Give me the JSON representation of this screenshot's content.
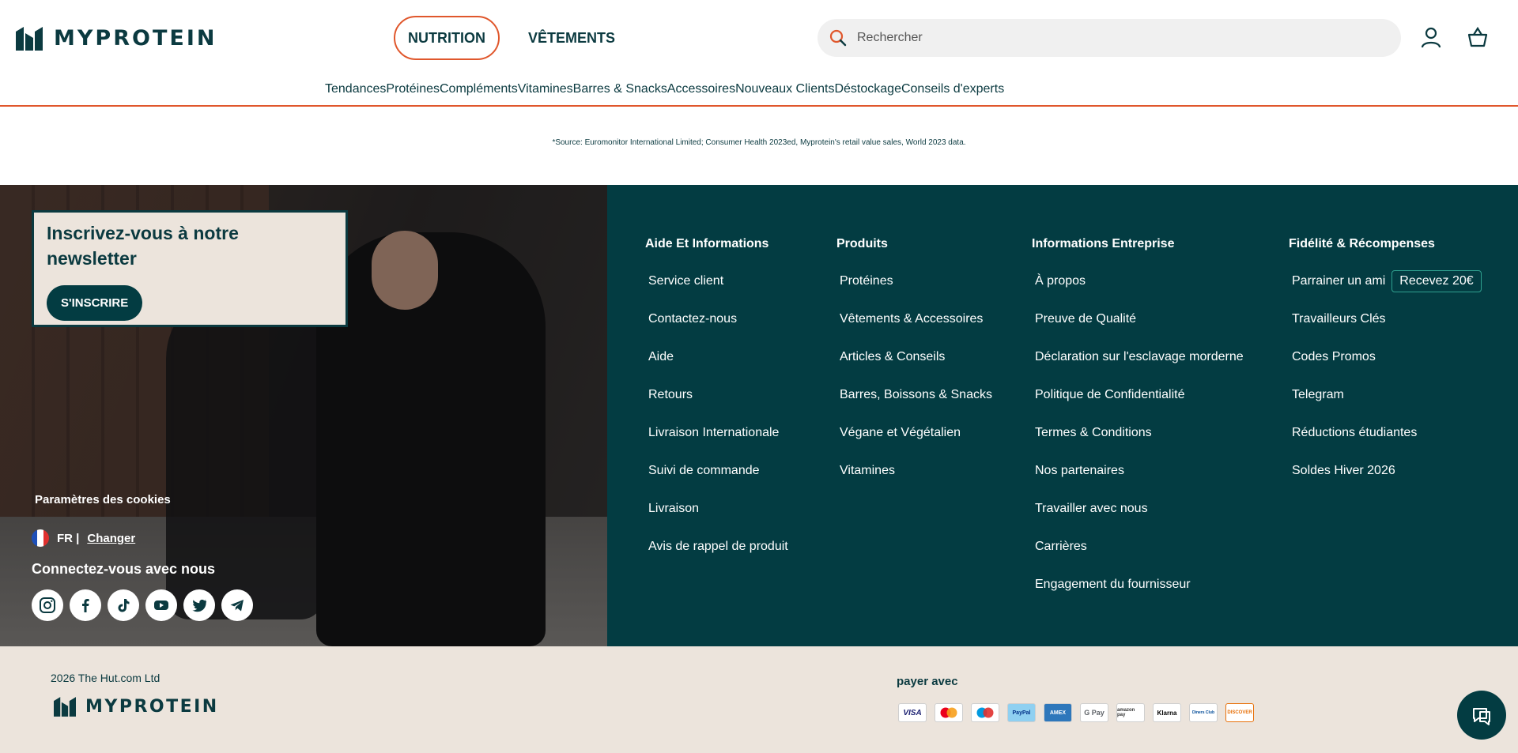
{
  "brand": {
    "name": "MYPROTEIN"
  },
  "header": {
    "tabs": [
      {
        "label": "NUTRITION",
        "active": true
      },
      {
        "label": "VÊTEMENTS",
        "active": false
      }
    ],
    "search": {
      "placeholder": "Rechercher",
      "value": ""
    },
    "icons": [
      "account-icon",
      "basket-icon"
    ]
  },
  "nav": [
    "Tendances",
    "Protéines",
    "Compléments",
    "Vitamines",
    "Barres & Snacks",
    "Accessoires",
    "Nouveaux Clients",
    "Déstockage",
    "Conseils d'experts"
  ],
  "source_note": "*Source: Euromonitor International Limited; Consumer Health 2023ed, Myprotein's retail value sales, World 2023 data.",
  "newsletter": {
    "title": "Inscrivez-vous à notre newsletter",
    "button": "S'INSCRIRE"
  },
  "cookies": "Paramètres des cookies",
  "locale": {
    "code": "FR |",
    "change": "Changer"
  },
  "connect": "Connectez-vous avec nous",
  "socials": [
    "instagram-icon",
    "facebook-icon",
    "tiktok-icon",
    "youtube-icon",
    "twitter-icon",
    "telegram-icon"
  ],
  "columns": [
    {
      "title": "Aide Et Informations",
      "items": [
        "Service client",
        "Contactez-nous",
        "Aide",
        "Retours",
        "Livraison Internationale",
        "Suivi de commande",
        "Livraison",
        "Avis de rappel de produit"
      ]
    },
    {
      "title": "Produits",
      "items": [
        "Protéines",
        "Vêtements & Accessoires",
        "Articles & Conseils",
        "Barres, Boissons & Snacks",
        "Végane et Végétalien",
        "Vitamines"
      ]
    },
    {
      "title": "Informations Entreprise",
      "items": [
        "À propos",
        "Preuve de Qualité",
        "Déclaration sur l'esclavage morderne",
        "Politique de Confidentialité",
        "Termes & Conditions",
        "Nos partenaires",
        "Travailler avec nous",
        "Carrières",
        "Engagement du fournisseur"
      ]
    },
    {
      "title": "Fidélité & Récompenses",
      "items": [
        "Parrainer un ami",
        "Travailleurs Clés",
        "Codes Promos",
        "Telegram",
        "Réductions étudiantes",
        "Soldes Hiver 2026"
      ],
      "badge": "Recevez 20€"
    }
  ],
  "bottom": {
    "copyright": "2026  The Hut.com Ltd",
    "pay_label": "payer avec",
    "payments": [
      "VISA",
      "Mastercard",
      "Maestro",
      "PayPal",
      "AMEX",
      "G Pay",
      "amazon pay",
      "Klarna",
      "Diners Club",
      "DISCOVER"
    ]
  },
  "colors": {
    "primary": "#033c42",
    "accent": "#e0572c",
    "beige": "#ece4dc"
  }
}
